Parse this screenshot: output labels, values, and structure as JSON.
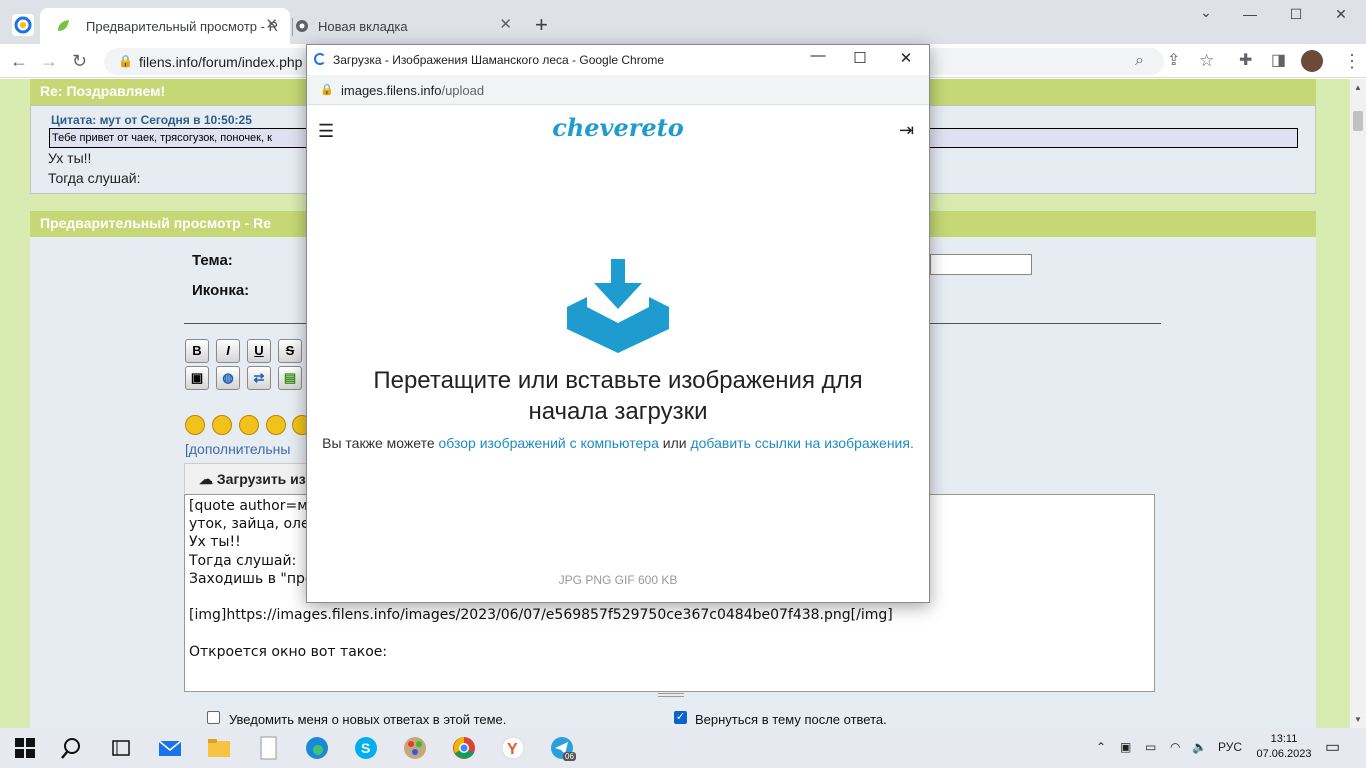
{
  "browser": {
    "tabs": [
      {
        "title": "Предварительный просмотр - R",
        "close": "✕"
      },
      {
        "title": "Новая вкладка",
        "close": "✕"
      }
    ],
    "new_tab": "+",
    "url": "filens.info/forum/index.php",
    "window_controls": {
      "minimize": "—",
      "maximize": "☐",
      "close": "✕"
    }
  },
  "forum": {
    "post_header": "Re: Поздравляем!",
    "quote_header": "Цитата: мут от Сегодня в 10:50:25",
    "quote_text": "Тебе привет от чаек, трясогузок, поночек, к",
    "post_lines": [
      "Ух ты!!",
      "Тогда слушай:"
    ],
    "preview_header": "Предварительный просмотр - Re",
    "subject_label": "Тема:",
    "icon_label": "Иконка:",
    "format_buttons": [
      "B",
      "I",
      "U",
      "S"
    ],
    "more_smileys": "[дополнительны",
    "upload_tab": "Загрузить из",
    "message_text": "[quote author=м                                                                                  трясогузок, поночек, крачек,\nуток, зайца, оле\nУх ты!!\nТогда слушай:\nЗаходишь в \"пре\n\n[img]https://images.filens.info/images/2023/06/07/e569857f529750ce367c0484be07f438.png[/img]\n\nОткроется окно вот такое:",
    "notify_label": "Уведомить меня о новых ответах в этой теме.",
    "notify_checked": false,
    "return_label": "Вернуться в тему после ответа.",
    "return_checked": true
  },
  "popup": {
    "title": "Загрузка - Изображения Шаманского леса - Google Chrome",
    "url_host": "images.filens.info",
    "url_path": "/upload",
    "logo": "chevereto",
    "drop_text_1": "Перетащите или вставьте изображения для",
    "drop_text_2": "начала загрузки",
    "also_prefix": "Вы также можете ",
    "browse_link": "обзор изображений с компьютера",
    "also_middle": " или ",
    "add_links_link": "добавить ссылки на изображения.",
    "formats": "JPG PNG GIF   600 KB",
    "accent_color": "#1e9ccf"
  },
  "taskbar": {
    "lang": "РУС",
    "time": "13:11",
    "date": "07.06.2023",
    "telegram_badge": "06"
  }
}
